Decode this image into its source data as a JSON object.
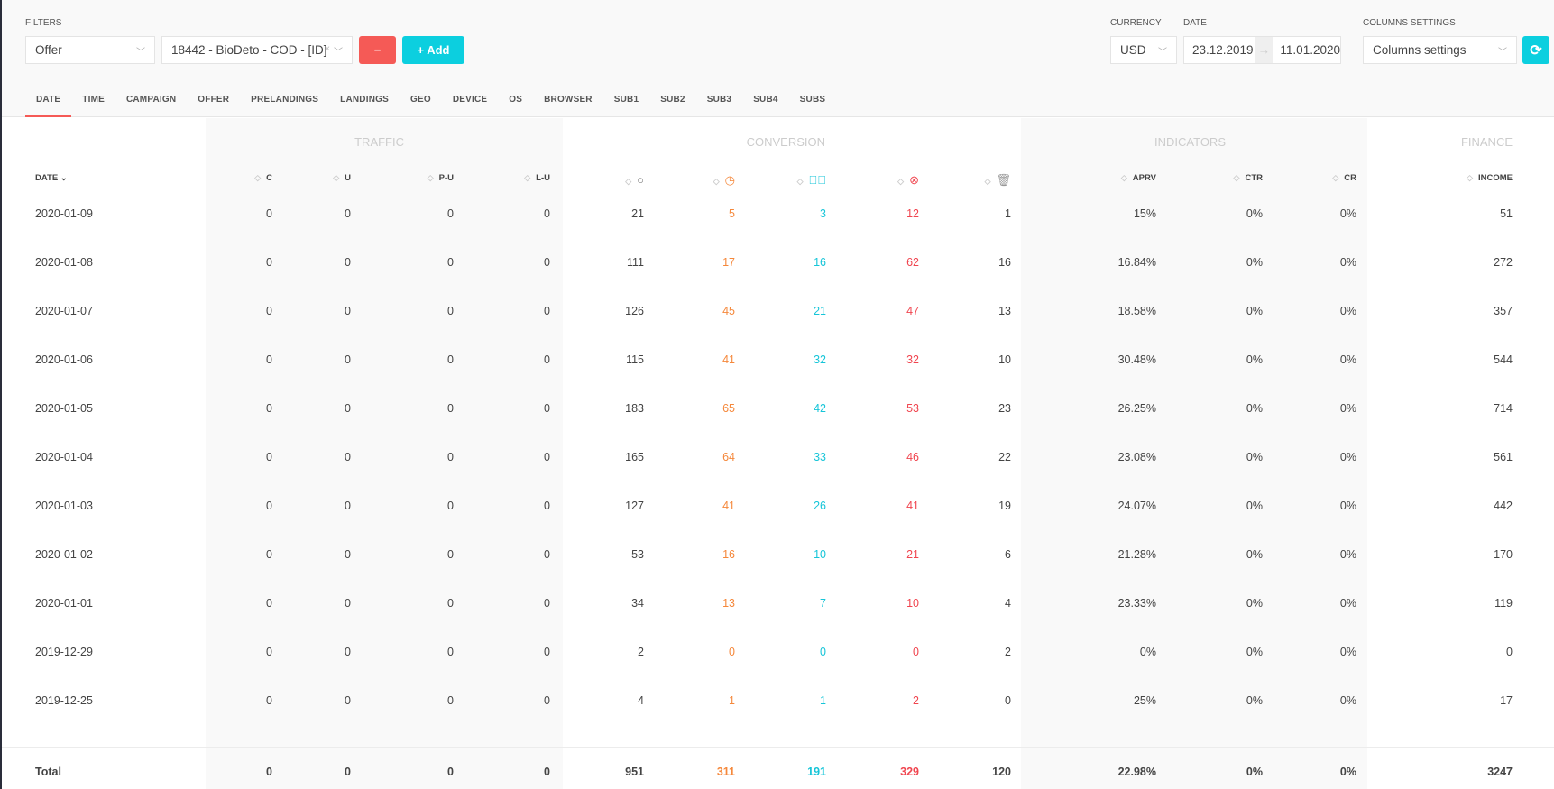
{
  "filters": {
    "label": "Filters",
    "type_value": "Offer",
    "offer_value": "18442 - BioDeto - COD - [ID]",
    "remove_label": "−",
    "add_label": "+ Add"
  },
  "currency": {
    "label": "Currency",
    "value": "USD"
  },
  "date": {
    "label": "Date",
    "from": "23.12.2019",
    "to": "11.01.2020",
    "arrow": "→"
  },
  "columns_settings": {
    "label": "Columns settings",
    "value": "Columns settings"
  },
  "tabs": [
    "DATE",
    "TIME",
    "CAMPAIGN",
    "OFFER",
    "PRELANDINGS",
    "LANDINGS",
    "GEO",
    "DEVICE",
    "OS",
    "BROWSER",
    "SUB1",
    "SUB2",
    "SUB3",
    "SUB4",
    "SUBS"
  ],
  "groups": {
    "traffic": "TRAFFIC",
    "conversion": "CONVERSION",
    "indicators": "INDICATORS",
    "finance": "FINANCE"
  },
  "columns": [
    "DATE",
    "C",
    "U",
    "P-U",
    "L-U",
    "all-icon",
    "pending-icon",
    "approved-icon",
    "rejected-icon",
    "trash-icon",
    "APRV",
    "CTR",
    "CR",
    "INCOME"
  ],
  "colors": {
    "orange": "#f5883b",
    "teal": "#16c5d8",
    "red": "#f0454f"
  },
  "rows": [
    [
      "2020-01-09",
      "0",
      "0",
      "0",
      "0",
      "21",
      "5",
      "3",
      "12",
      "1",
      "15%",
      "0%",
      "0%",
      "51"
    ],
    [
      "2020-01-08",
      "0",
      "0",
      "0",
      "0",
      "111",
      "17",
      "16",
      "62",
      "16",
      "16.84%",
      "0%",
      "0%",
      "272"
    ],
    [
      "2020-01-07",
      "0",
      "0",
      "0",
      "0",
      "126",
      "45",
      "21",
      "47",
      "13",
      "18.58%",
      "0%",
      "0%",
      "357"
    ],
    [
      "2020-01-06",
      "0",
      "0",
      "0",
      "0",
      "115",
      "41",
      "32",
      "32",
      "10",
      "30.48%",
      "0%",
      "0%",
      "544"
    ],
    [
      "2020-01-05",
      "0",
      "0",
      "0",
      "0",
      "183",
      "65",
      "42",
      "53",
      "23",
      "26.25%",
      "0%",
      "0%",
      "714"
    ],
    [
      "2020-01-04",
      "0",
      "0",
      "0",
      "0",
      "165",
      "64",
      "33",
      "46",
      "22",
      "23.08%",
      "0%",
      "0%",
      "561"
    ],
    [
      "2020-01-03",
      "0",
      "0",
      "0",
      "0",
      "127",
      "41",
      "26",
      "41",
      "19",
      "24.07%",
      "0%",
      "0%",
      "442"
    ],
    [
      "2020-01-02",
      "0",
      "0",
      "0",
      "0",
      "53",
      "16",
      "10",
      "21",
      "6",
      "21.28%",
      "0%",
      "0%",
      "170"
    ],
    [
      "2020-01-01",
      "0",
      "0",
      "0",
      "0",
      "34",
      "13",
      "7",
      "10",
      "4",
      "23.33%",
      "0%",
      "0%",
      "119"
    ],
    [
      "2019-12-29",
      "0",
      "0",
      "0",
      "0",
      "2",
      "0",
      "0",
      "0",
      "2",
      "0%",
      "0%",
      "0%",
      "0"
    ],
    [
      "2019-12-25",
      "0",
      "0",
      "0",
      "0",
      "4",
      "1",
      "1",
      "2",
      "0",
      "25%",
      "0%",
      "0%",
      "17"
    ]
  ],
  "total": [
    "Total",
    "0",
    "0",
    "0",
    "0",
    "951",
    "311",
    "191",
    "329",
    "120",
    "22.98%",
    "0%",
    "0%",
    "3247"
  ]
}
